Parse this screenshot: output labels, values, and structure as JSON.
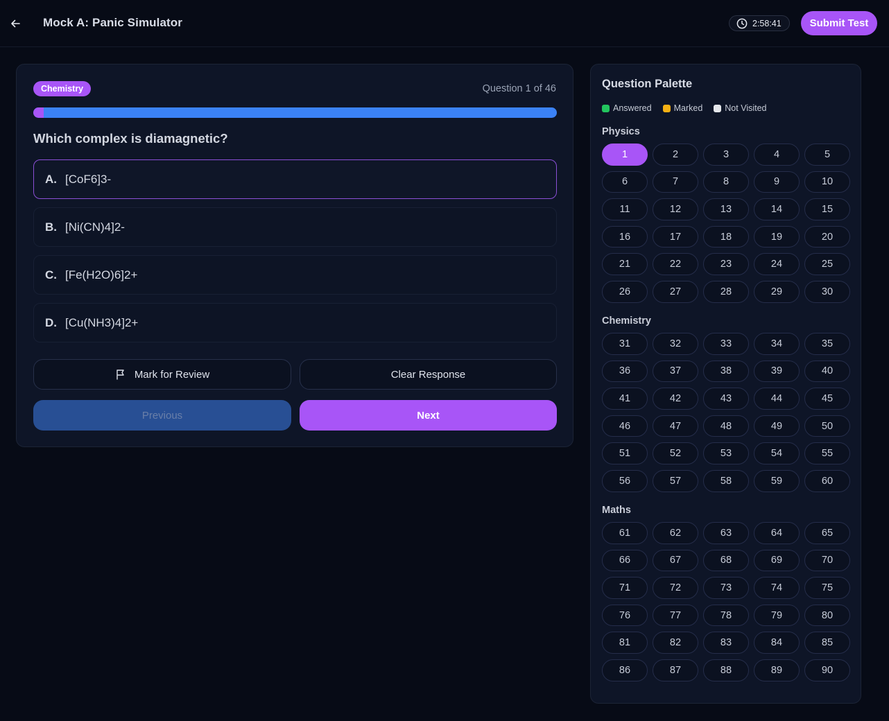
{
  "header": {
    "back_icon": "arrow-left-icon",
    "title": "Mock A: Panic Simulator",
    "timer_icon": "clock-icon",
    "timer": "2:58:41",
    "submit_label": "Submit Test"
  },
  "question": {
    "subject": "Chemistry",
    "counter": "Question 1 of 46",
    "progress_fraction": 0.02,
    "text": "Which complex is diamagnetic?",
    "options": [
      {
        "letter": "A.",
        "text": "[CoF6]3-",
        "selected": true
      },
      {
        "letter": "B.",
        "text": "[Ni(CN)4]2-",
        "selected": false
      },
      {
        "letter": "C.",
        "text": "[Fe(H2O)6]2+",
        "selected": false
      },
      {
        "letter": "D.",
        "text": "[Cu(NH3)4]2+",
        "selected": false
      }
    ],
    "mark_label": "Mark for Review",
    "mark_icon": "flag-icon",
    "clear_label": "Clear Response",
    "prev_label": "Previous",
    "next_label": "Next"
  },
  "palette": {
    "title": "Question Palette",
    "legend": [
      {
        "label": "Answered",
        "color": "#22c55e"
      },
      {
        "label": "Marked",
        "color": "#f5b014"
      },
      {
        "label": "Not Visited",
        "color": "#e5e7eb"
      }
    ],
    "current": 1,
    "sections": [
      {
        "name": "Physics",
        "numbers": [
          "1",
          "2",
          "3",
          "4",
          "5",
          "6",
          "7",
          "8",
          "9",
          "10",
          "11",
          "12",
          "13",
          "14",
          "15",
          "16",
          "17",
          "18",
          "19",
          "20",
          "21",
          "22",
          "23",
          "24",
          "25",
          "26",
          "27",
          "28",
          "29",
          "30"
        ]
      },
      {
        "name": "Chemistry",
        "numbers": [
          "31",
          "32",
          "33",
          "34",
          "35",
          "36",
          "37",
          "38",
          "39",
          "40",
          "41",
          "42",
          "43",
          "44",
          "45",
          "46",
          "47",
          "48",
          "49",
          "50",
          "51",
          "52",
          "53",
          "54",
          "55",
          "56",
          "57",
          "58",
          "59",
          "60"
        ]
      },
      {
        "name": "Maths",
        "numbers": [
          "61",
          "62",
          "63",
          "64",
          "65",
          "66",
          "67",
          "68",
          "69",
          "70",
          "71",
          "72",
          "73",
          "74",
          "75",
          "76",
          "77",
          "78",
          "79",
          "80",
          "81",
          "82",
          "83",
          "84",
          "85",
          "86",
          "87",
          "88",
          "89",
          "90"
        ]
      }
    ]
  },
  "colors": {
    "accent": "#a855f7",
    "progress": "#3b82f6",
    "background": "#070b16"
  }
}
